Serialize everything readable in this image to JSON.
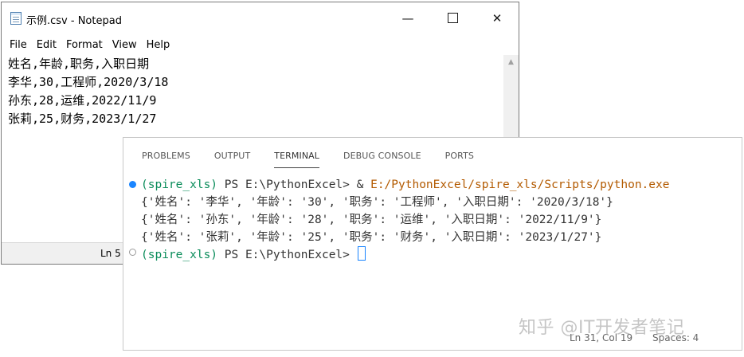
{
  "notepad": {
    "title": "示例.csv - Notepad",
    "window_controls": {
      "minimize": "—",
      "close": "✕"
    },
    "menu": [
      "File",
      "Edit",
      "Format",
      "View",
      "Help"
    ],
    "lines": [
      "姓名,年龄,职务,入职日期",
      "李华,30,工程师,2020/3/18",
      "孙东,28,运维,2022/11/9",
      "张莉,25,财务,2023/1/27"
    ],
    "status_position": "Ln 5"
  },
  "terminal": {
    "tabs": [
      "PROBLEMS",
      "OUTPUT",
      "TERMINAL",
      "DEBUG CONSOLE",
      "PORTS"
    ],
    "active_tab": "TERMINAL",
    "command_line": {
      "env": "(spire_xls)",
      "prompt": " PS E:\\PythonExcel> & ",
      "path": "E:/PythonExcel/spire_xls/Scripts/python.exe"
    },
    "output": [
      "{'姓名': '李华', '年龄': '30', '职务': '工程师', '入职日期': '2020/3/18'}",
      "{'姓名': '孙东', '年龄': '28', '职务': '运维', '入职日期': '2022/11/9'}",
      "{'姓名': '张莉', '年龄': '25', '职务': '财务', '入职日期': '2023/1/27'}"
    ],
    "prompt_line": {
      "env": "(spire_xls)",
      "prompt": " PS E:\\PythonExcel> "
    },
    "status": {
      "position": "Ln 31, Col 19",
      "spaces": "Spaces: 4"
    }
  },
  "watermark": "知乎 @IT开发者笔记",
  "colors": {
    "accent": "#1a85ff",
    "env": "#0a8c5a",
    "path": "#b35a00"
  }
}
